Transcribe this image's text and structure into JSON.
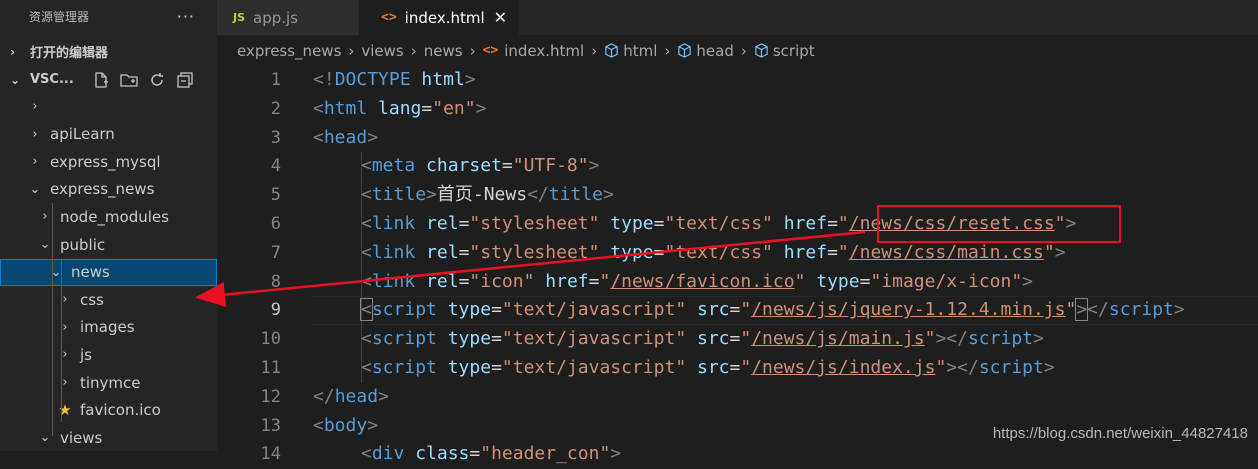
{
  "sidebar": {
    "title": "资源管理器",
    "more": "···",
    "open_editors": "打开的编辑器",
    "workspace": "VSC...",
    "tree": [
      {
        "label": "",
        "chev": "›",
        "depth": 0
      },
      {
        "label": "apiLearn",
        "chev": "›",
        "depth": 0
      },
      {
        "label": "express_mysql",
        "chev": "›",
        "depth": 0
      },
      {
        "label": "express_news",
        "chev": "⌄",
        "depth": 0
      },
      {
        "label": "node_modules",
        "chev": "›",
        "depth": 1
      },
      {
        "label": "public",
        "chev": "⌄",
        "depth": 1
      },
      {
        "label": "news",
        "chev": "⌄",
        "depth": 2,
        "selected": true
      },
      {
        "label": "css",
        "chev": "›",
        "depth": 3
      },
      {
        "label": "images",
        "chev": "›",
        "depth": 3
      },
      {
        "label": "js",
        "chev": "›",
        "depth": 3
      },
      {
        "label": "tinymce",
        "chev": "›",
        "depth": 3
      },
      {
        "label": "favicon.ico",
        "icon": "star-icon",
        "depth": 3
      },
      {
        "label": "views",
        "chev": "⌄",
        "depth": 1
      }
    ]
  },
  "tabs": [
    {
      "badge": "JS",
      "label": "app.js",
      "active": false
    },
    {
      "badge": "<>",
      "label": "index.html",
      "active": true,
      "close": "✕"
    }
  ],
  "breadcrumb": [
    "express_news",
    "views",
    "news",
    "index.html",
    "html",
    "head",
    "script"
  ],
  "editor": {
    "current_line": 9,
    "lines": [
      {
        "n": "1",
        "ind": 0,
        "tokens": [
          [
            "p",
            "<!"
          ],
          [
            "t",
            "DOCTYPE"
          ],
          [
            "x",
            " "
          ],
          [
            "a",
            "html"
          ],
          [
            "p",
            ">"
          ]
        ]
      },
      {
        "n": "2",
        "ind": 0,
        "tokens": [
          [
            "p",
            "<"
          ],
          [
            "t",
            "html"
          ],
          [
            "x",
            " "
          ],
          [
            "a",
            "lang"
          ],
          [
            "x",
            "="
          ],
          [
            "s",
            "\"en\""
          ],
          [
            "p",
            ">"
          ]
        ]
      },
      {
        "n": "3",
        "ind": 0,
        "tokens": [
          [
            "p",
            "<"
          ],
          [
            "t",
            "head"
          ],
          [
            "p",
            ">"
          ]
        ]
      },
      {
        "n": "4",
        "ind": 1,
        "tokens": [
          [
            "p",
            "<"
          ],
          [
            "t",
            "meta"
          ],
          [
            "x",
            " "
          ],
          [
            "a",
            "charset"
          ],
          [
            "x",
            "="
          ],
          [
            "s",
            "\"UTF-8\""
          ],
          [
            "p",
            ">"
          ]
        ]
      },
      {
        "n": "5",
        "ind": 1,
        "tokens": [
          [
            "p",
            "<"
          ],
          [
            "t",
            "title"
          ],
          [
            "p",
            ">"
          ],
          [
            "x",
            "首页-News"
          ],
          [
            "p",
            "</"
          ],
          [
            "t",
            "title"
          ],
          [
            "p",
            ">"
          ]
        ]
      },
      {
        "n": "6",
        "ind": 1,
        "tokens": [
          [
            "p",
            "<"
          ],
          [
            "t",
            "link"
          ],
          [
            "x",
            " "
          ],
          [
            "a",
            "rel"
          ],
          [
            "x",
            "="
          ],
          [
            "s",
            "\"stylesheet\""
          ],
          [
            "x",
            " "
          ],
          [
            "a",
            "type"
          ],
          [
            "x",
            "="
          ],
          [
            "s",
            "\"text/css\""
          ],
          [
            "x",
            " "
          ],
          [
            "a",
            "href"
          ],
          [
            "x",
            "="
          ],
          [
            "s",
            "\""
          ],
          [
            "sl",
            "/news/css/reset.css"
          ],
          [
            "s",
            "\""
          ],
          [
            "p",
            ">"
          ]
        ]
      },
      {
        "n": "7",
        "ind": 1,
        "tokens": [
          [
            "p",
            "<"
          ],
          [
            "t",
            "link"
          ],
          [
            "x",
            " "
          ],
          [
            "a",
            "rel"
          ],
          [
            "x",
            "="
          ],
          [
            "s",
            "\"stylesheet\""
          ],
          [
            "x",
            " "
          ],
          [
            "a",
            "type"
          ],
          [
            "x",
            "="
          ],
          [
            "s",
            "\"text/css\""
          ],
          [
            "x",
            " "
          ],
          [
            "a",
            "href"
          ],
          [
            "x",
            "="
          ],
          [
            "s",
            "\""
          ],
          [
            "sl",
            "/news/css/main.css"
          ],
          [
            "s",
            "\""
          ],
          [
            "p",
            ">"
          ]
        ]
      },
      {
        "n": "8",
        "ind": 1,
        "tokens": [
          [
            "p",
            "<"
          ],
          [
            "t",
            "link"
          ],
          [
            "x",
            " "
          ],
          [
            "a",
            "rel"
          ],
          [
            "x",
            "="
          ],
          [
            "s",
            "\"icon\""
          ],
          [
            "x",
            " "
          ],
          [
            "a",
            "href"
          ],
          [
            "x",
            "="
          ],
          [
            "s",
            "\""
          ],
          [
            "sl",
            "/news/favicon.ico"
          ],
          [
            "s",
            "\""
          ],
          [
            "x",
            " "
          ],
          [
            "a",
            "type"
          ],
          [
            "x",
            "="
          ],
          [
            "s",
            "\"image/x-icon\""
          ],
          [
            "p",
            ">"
          ]
        ]
      },
      {
        "n": "9",
        "ind": 1,
        "tokens": [
          [
            "pb",
            "<"
          ],
          [
            "t",
            "script"
          ],
          [
            "x",
            " "
          ],
          [
            "a",
            "type"
          ],
          [
            "x",
            "="
          ],
          [
            "s",
            "\"text/javascript\""
          ],
          [
            "x",
            " "
          ],
          [
            "a",
            "src"
          ],
          [
            "x",
            "="
          ],
          [
            "s",
            "\""
          ],
          [
            "sl",
            "/news/js/jquery-1.12.4.min.js"
          ],
          [
            "s",
            "\""
          ],
          [
            "pb",
            ">"
          ],
          [
            "p",
            "</"
          ],
          [
            "t",
            "script"
          ],
          [
            "p",
            ">"
          ]
        ]
      },
      {
        "n": "10",
        "ind": 1,
        "tokens": [
          [
            "p",
            "<"
          ],
          [
            "t",
            "script"
          ],
          [
            "x",
            " "
          ],
          [
            "a",
            "type"
          ],
          [
            "x",
            "="
          ],
          [
            "s",
            "\"text/javascript\""
          ],
          [
            "x",
            " "
          ],
          [
            "a",
            "src"
          ],
          [
            "x",
            "="
          ],
          [
            "s",
            "\""
          ],
          [
            "sl",
            "/news/js/main.js"
          ],
          [
            "s",
            "\""
          ],
          [
            "p",
            ">"
          ],
          [
            "p",
            "</"
          ],
          [
            "t",
            "script"
          ],
          [
            "p",
            ">"
          ]
        ]
      },
      {
        "n": "11",
        "ind": 1,
        "tokens": [
          [
            "p",
            "<"
          ],
          [
            "t",
            "script"
          ],
          [
            "x",
            " "
          ],
          [
            "a",
            "type"
          ],
          [
            "x",
            "="
          ],
          [
            "s",
            "\"text/javascript\""
          ],
          [
            "x",
            " "
          ],
          [
            "a",
            "src"
          ],
          [
            "x",
            "="
          ],
          [
            "s",
            "\""
          ],
          [
            "sl",
            "/news/js/index.js"
          ],
          [
            "s",
            "\""
          ],
          [
            "p",
            ">"
          ],
          [
            "p",
            "</"
          ],
          [
            "t",
            "script"
          ],
          [
            "p",
            ">"
          ]
        ]
      },
      {
        "n": "12",
        "ind": 0,
        "tokens": [
          [
            "p",
            "</"
          ],
          [
            "t",
            "head"
          ],
          [
            "p",
            ">"
          ]
        ]
      },
      {
        "n": "13",
        "ind": 0,
        "tokens": [
          [
            "p",
            "<"
          ],
          [
            "t",
            "body"
          ],
          [
            "p",
            ">"
          ]
        ]
      },
      {
        "n": "14",
        "ind": 1,
        "tokens": [
          [
            "p",
            "<"
          ],
          [
            "t",
            "div"
          ],
          [
            "x",
            " "
          ],
          [
            "a",
            "class"
          ],
          [
            "x",
            "="
          ],
          [
            "s",
            "\"header_con\""
          ],
          [
            "p",
            ">"
          ]
        ]
      }
    ]
  },
  "watermark": "https://blog.csdn.net/weixin_44827418",
  "colors": {
    "annotation": "#e81123",
    "selection": "#094771",
    "accent": "#007fd4"
  }
}
